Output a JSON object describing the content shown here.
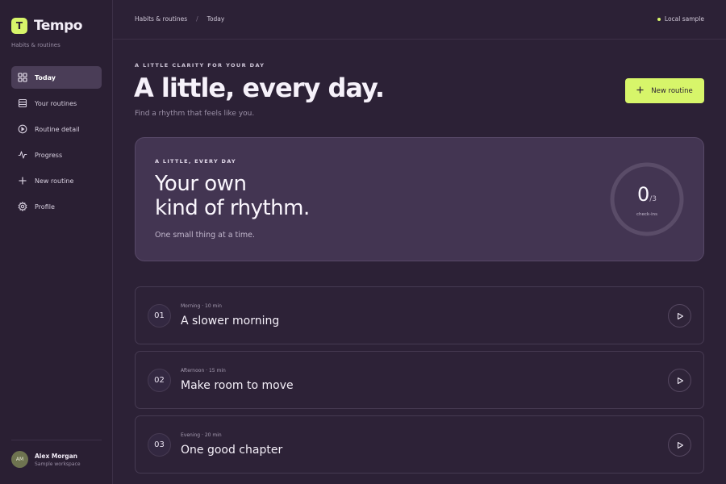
{
  "brand": {
    "mark": "T",
    "name": "Tempo",
    "subtitle": "Habits & routines"
  },
  "sidebar": {
    "items": [
      {
        "label": "Today",
        "icon": "grid-icon",
        "active": true
      },
      {
        "label": "Your routines",
        "icon": "list-icon",
        "active": false
      },
      {
        "label": "Routine detail",
        "icon": "circle-play-icon",
        "active": false
      },
      {
        "label": "Progress",
        "icon": "activity-icon",
        "active": false
      },
      {
        "label": "New routine",
        "icon": "plus-icon",
        "active": false
      },
      {
        "label": "Profile",
        "icon": "gear-icon",
        "active": false
      }
    ]
  },
  "user": {
    "initials": "AM",
    "name": "Alex Morgan",
    "workspace": "Sample workspace"
  },
  "topbar": {
    "breadcrumb": [
      "Habits & routines",
      "Today"
    ],
    "separator": "/",
    "status": "Local sample"
  },
  "header": {
    "eyebrow": "A LITTLE CLARITY FOR YOUR DAY",
    "title": "A little, every day.",
    "subtitle": "Find a rhythm that feels like you.",
    "new_button": "New routine"
  },
  "hero": {
    "eyebrow": "A LITTLE, EVERY DAY",
    "title_line1": "Your own",
    "title_line2": "kind of rhythm.",
    "subtitle": "One small thing at a time.",
    "checkins_done": "0",
    "checkins_total": "/3",
    "checkins_label": "check-ins",
    "progress": 0
  },
  "routines": [
    {
      "number": "01",
      "meta": "Morning · 10 min",
      "title": "A slower morning"
    },
    {
      "number": "02",
      "meta": "Afternoon · 15 min",
      "title": "Make room to move"
    },
    {
      "number": "03",
      "meta": "Evening · 20 min",
      "title": "One good chapter"
    }
  ],
  "colors": {
    "accent": "#d7f56a",
    "background": "#2c2136",
    "card": "#433552"
  }
}
